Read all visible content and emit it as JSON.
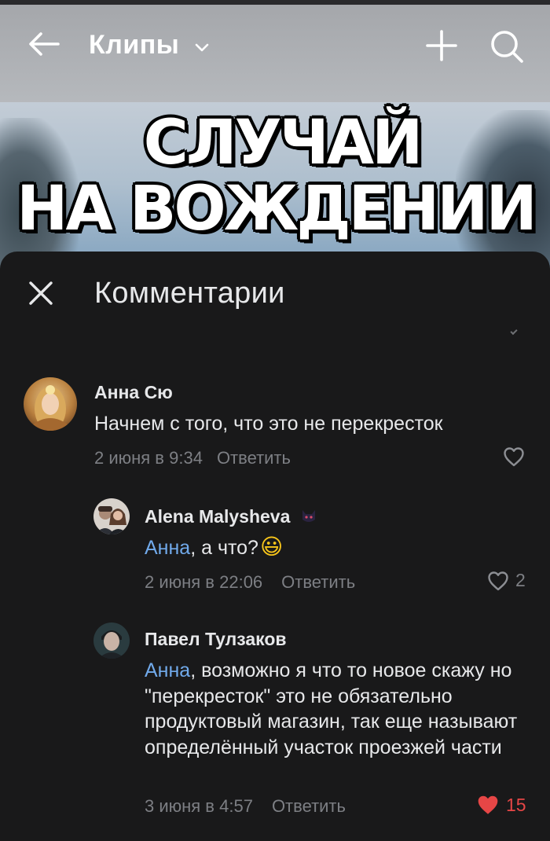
{
  "appbar": {
    "title": "Клипы"
  },
  "video": {
    "headline_line1": "СЛУЧАЙ",
    "headline_line2": "НА ВОЖДЕНИИ"
  },
  "comments_panel": {
    "title": "Комментарии",
    "comments": [
      {
        "author": "Анна Сю",
        "text": "Начнем с того, что это не перекресток",
        "date": "2 июня в 9:34",
        "reply_label": "Ответить",
        "likes": ""
      },
      {
        "author": "Alena Malysheva",
        "mention": "Анна",
        "text": ", а что?",
        "emoji": "😃",
        "date": "2 июня в 22:06",
        "reply_label": "Ответить",
        "likes": "2"
      },
      {
        "author": "Павел Тулзаков",
        "mention": "Анна",
        "text": ", возможно я что то новое скажу но \"перекресток\" это не обязательно продуктовый магазин, так еще называют определённый участок проезжей части",
        "date": "3 июня в 4:57",
        "reply_label": "Ответить",
        "likes": "15"
      }
    ]
  },
  "colors": {
    "sheet_bg": "#19191a",
    "mention": "#71aaeb",
    "liked": "#e64646",
    "secondary_text": "#7d7f84"
  }
}
